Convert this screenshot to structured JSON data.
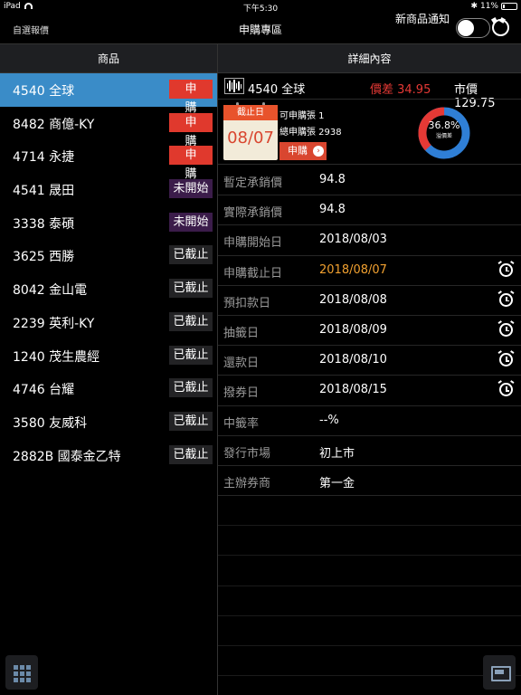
{
  "status_bar": {
    "device": "iPad",
    "time": "下午5:30",
    "battery": "11%"
  },
  "nav": {
    "left": "自選報價",
    "title": "申購專區",
    "notify_label": "新商品通知"
  },
  "columns": {
    "left": "商品",
    "right": "詳細內容"
  },
  "list": [
    {
      "name": "4540 全球",
      "badge": "申購",
      "type": "red",
      "selected": true
    },
    {
      "name": "8482 商億-KY",
      "badge": "申購",
      "type": "red"
    },
    {
      "name": "4714 永捷",
      "badge": "申購",
      "type": "red"
    },
    {
      "name": "4541 晟田",
      "badge": "未開始",
      "type": "purple"
    },
    {
      "name": "3338 泰碩",
      "badge": "未開始",
      "type": "purple"
    },
    {
      "name": "3625 西勝",
      "badge": "已截止",
      "type": "grey"
    },
    {
      "name": "8042 金山電",
      "badge": "已截止",
      "type": "grey"
    },
    {
      "name": "2239 英利-KY",
      "badge": "已截止",
      "type": "grey"
    },
    {
      "name": "1240 茂生農經",
      "badge": "已截止",
      "type": "grey"
    },
    {
      "name": "4746 台耀",
      "badge": "已截止",
      "type": "grey"
    },
    {
      "name": "3580 友威科",
      "badge": "已截止",
      "type": "grey"
    },
    {
      "name": "2882B 國泰金乙特",
      "badge": "已截止",
      "type": "grey"
    }
  ],
  "detail": {
    "stock_name": "4540 全球",
    "diff": "價差 34.95",
    "price": "市價 129.75",
    "calendar_label": "截止日",
    "calendar_date": "08/07",
    "line1": "可申購張 1",
    "line2": "總申購張 2938",
    "button_label": "申購",
    "donut": {
      "percent_text": "36.8%",
      "sub_text": "溢價差",
      "value": 36.8,
      "color_main": "#2f7fd6",
      "color_part": "#e53935"
    },
    "fields": [
      {
        "k": "暫定承銷價",
        "v": "94.8",
        "alarm": false
      },
      {
        "k": "實際承銷價",
        "v": "94.8",
        "alarm": false
      },
      {
        "k": "申購開始日",
        "v": "2018/08/03",
        "alarm": false
      },
      {
        "k": "申購截止日",
        "v": "2018/08/07",
        "alarm": true,
        "highlight": true
      },
      {
        "k": "預扣款日",
        "v": "2018/08/08",
        "alarm": true
      },
      {
        "k": "抽籤日",
        "v": "2018/08/09",
        "alarm": true
      },
      {
        "k": "還款日",
        "v": "2018/08/10",
        "alarm": true
      },
      {
        "k": "撥券日",
        "v": "2018/08/15",
        "alarm": true
      },
      {
        "k": "中籤率",
        "v": "--%",
        "alarm": false
      },
      {
        "k": "發行市場",
        "v": "初上市",
        "alarm": false
      },
      {
        "k": "主辦券商",
        "v": "第一金",
        "alarm": false
      }
    ]
  },
  "colors": {
    "accent_blue": "#3a8cc8",
    "red": "#e0392d",
    "orange": "#f0a030"
  }
}
